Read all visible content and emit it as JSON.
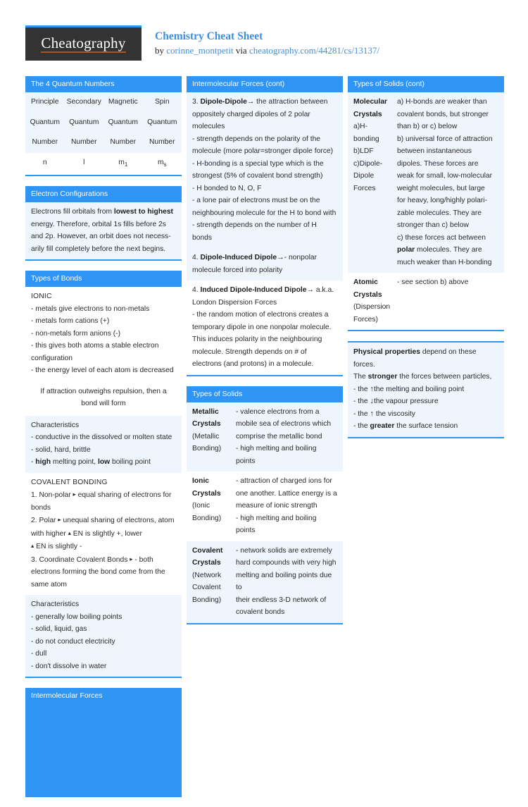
{
  "header": {
    "logo_text": "Cheatography",
    "title": "Chemistry Cheat Sheet",
    "by_prefix": "by ",
    "author": "corinne_montpetit",
    "via": " via ",
    "url": "cheatography.com/44281/cs/13137/"
  },
  "col1": {
    "quantum": {
      "title": "The 4 Quantum Numbers",
      "header_row": [
        "Principle Quantum Number",
        "Secondary Quantum Number",
        "Magnetic Quantum Number",
        "Spin Quantum Number"
      ],
      "header_lines": [
        [
          "Principle",
          "Secondary",
          "Magnetic",
          "Spin"
        ],
        [
          "Quantum",
          "Quantum",
          "Quantum",
          "Quantum"
        ],
        [
          "Number",
          "Number",
          "Number",
          "Number"
        ]
      ],
      "value_row": [
        "n",
        "l",
        "m",
        "m"
      ],
      "value_subs": [
        "",
        "",
        "1",
        "s"
      ]
    },
    "electron_config": {
      "title": "Electron Configurations",
      "text_1": "Electrons fill orbitals from ",
      "bold_1": "lowest to highest",
      "text_2": " energy. Therefore, orbital 1s fills before 2s and 2p. However, an orbit does not necess­arily fill completely before the next begins."
    },
    "bonds": {
      "title": "Types of Bonds",
      "ionic_heading": "IONIC",
      "ionic_lines": [
        "- metals give electrons to non-metals",
        "- metals form cations (+)",
        "- non-metals form anions (-)",
        "- this gives both atoms a stable electron configuration",
        "- the energy level of each atom is decreased"
      ],
      "note": "If attraction outweighs repulsion, then a bond will form",
      "char_heading_1": "Characteristics",
      "char_lines_1": [
        "- conductive in the dissolved or molten state",
        "- solid, hard, brittle"
      ],
      "char_bold_line": {
        "pre": "- ",
        "b1": "high",
        "mid": " melting point, ",
        "b2": "low",
        "post": " boiling point"
      },
      "covalent_heading": "COVALENT BONDING",
      "covalent_1_pre": "1. Non-polar ",
      "covalent_1_post": " equal sharing of electrons for bonds",
      "covalent_2_pre": "2. Polar ",
      "covalent_2_mid": " unequal sharing of electrons, atom with higher ",
      "covalent_2_mid2": " EN is slightly +, lower",
      "covalent_2_post": " EN is slightly -",
      "covalent_3_pre": "3. Coordinate Covalent Bonds ",
      "covalent_3_post": " - both electrons forming the bond come from the same atom",
      "char_heading_2": "Characteristics",
      "char_lines_2": [
        "- generally low boiling points",
        "- solid, liquid, gas",
        "- do not conduct electricity",
        "- dull",
        "- don't dissolve in water"
      ]
    },
    "imf_empty": {
      "title": "Intermolecular Forces"
    }
  },
  "col2": {
    "imf_cont": {
      "title": "Intermolecular Forces (cont)",
      "item3": {
        "num": "3. ",
        "bold": "Dipole-Dipole",
        "arrow": "→",
        "text": " the attraction between oppositely charged dipoles of 2 polar molecules"
      },
      "item3_bullets": [
        "- strength depends on the polarity of the molecule (more polar=stronger dipole force)",
        "- H-bonding is a special type which is the strongest (5% of covalent bond strength)",
        "- H bonded to N, O, F",
        "- a lone pair of electrons must be on the neighbouring molecule for the H to bond with",
        "- strength depends on the number of H bonds"
      ],
      "item4a": {
        "num": "4. ",
        "bold": "Dipole-Induced Dipole",
        "arrow": "→",
        "text": "- nonpolar molecule forced into polarity"
      },
      "item4b": {
        "num": "4. ",
        "bold": "Induced Dipole-Induced Dipole",
        "arrow": "→",
        "text": " a.k.a. London Dispersion Forces"
      },
      "item4b_body": "- the random motion of electrons creates a temporary dipole in one nonpolar molecule. This induces polarity in the neighbouring molecule. Strength depends on # of electrons (and protons) in a molecule."
    },
    "solids": {
      "title": "Types of Solids",
      "rows": [
        {
          "label_lines": [
            "Metallic",
            "Crystals",
            "(Metallic",
            "Bonding)"
          ],
          "label_bold": [
            true,
            true,
            false,
            false
          ],
          "body_lines": [
            "- valence electrons from a",
            "mobile sea of electrons which",
            "comprise the metallic bond",
            "- high melting and boiling points"
          ]
        },
        {
          "label_lines": [
            "Ionic",
            "Crystals",
            "(Ionic",
            "Bonding)"
          ],
          "label_bold": [
            true,
            true,
            false,
            false
          ],
          "body_lines": [
            "- attraction of charged ions for",
            "one another. Lattice energy is a",
            "measure of ionic strength",
            "- high melting and boiling points"
          ]
        },
        {
          "label_lines": [
            "Covalent",
            "Crystals",
            "(Network",
            "Covalent",
            "Bonding)"
          ],
          "label_bold": [
            true,
            true,
            false,
            false,
            false
          ],
          "body_lines": [
            "- network solids are extremely",
            "hard compounds with very high",
            "melting and boiling points due to",
            "their endless 3-D network of",
            "covalent bonds"
          ]
        }
      ]
    }
  },
  "col3": {
    "solids_cont": {
      "title": "Types of Solids (cont)",
      "rows": [
        {
          "label_lines": [
            "Molecular",
            "Crystals",
            "a)H-",
            "bonding",
            "b)LDF",
            "c)Dipole-",
            "Dipole",
            "Forces"
          ],
          "label_bold": [
            true,
            true,
            false,
            false,
            false,
            false,
            false,
            false
          ],
          "body_lines": [
            "a) H-bonds are weaker than",
            "covalent bonds, but stronger",
            "than b) or c) below",
            "b) universal force of attraction",
            "between instantaneous",
            "dipoles. These forces are",
            "weak for small, low-molecular",
            "weight molecules, but large",
            "for heavy, long/highly polari-",
            "zable molecules. They are",
            "stronger than c) below",
            "c) these forces act between"
          ],
          "body_bold_line": {
            "b": "polar",
            "post": " molecules. They are"
          },
          "body_tail": [
            "much weaker than H-bonding"
          ]
        },
        {
          "label_lines": [
            "Atomic",
            "Crystals",
            "(Dispersion",
            "Forces)"
          ],
          "label_bold": [
            true,
            true,
            false,
            false
          ],
          "body_lines": [
            "- see section b) above"
          ]
        }
      ]
    },
    "physical": {
      "line1_b": "Physical properties",
      "line1_post": " depend on these forces.",
      "line2_pre": "The ",
      "line2_b": "stronger",
      "line2_post": " the forces between particles,",
      "bullets": [
        {
          "pre": "- the ",
          "icon": "↑",
          "post": "the melting and boiling point"
        },
        {
          "pre": "- the ",
          "icon": "↓",
          "post": "the vapour pressure"
        },
        {
          "pre": "- the ",
          "icon": "↑",
          "post": " the viscosity"
        }
      ],
      "last_pre": "- the ",
      "last_b": "greater",
      "last_post": " the surface tension"
    }
  },
  "glyphs": {
    "triangle_right": "▸",
    "triangle_up": "▴",
    "arrow_right": "→",
    "arrow_up": "↑",
    "arrow_down": "↓"
  },
  "colors": {
    "accent": "#2f95f5",
    "row_tint": "#eef5fd",
    "logo_bg": "#333333",
    "logo_underline": "#b5521a",
    "link": "#3f8fe0"
  }
}
